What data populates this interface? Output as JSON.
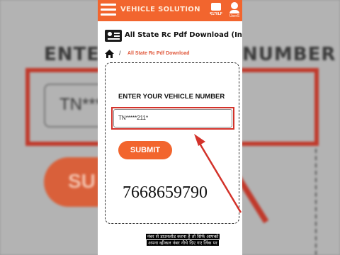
{
  "app": {
    "title": "VEHICLE SOLUTION",
    "wallet_amount": "₹170LF",
    "user_label": "UserS"
  },
  "background": {
    "heading_left": "ENTER",
    "heading_right": "NUMBER",
    "input_value": "TN***",
    "submit_label": "SU"
  },
  "page": {
    "title": "All State Rc Pdf Download (Instan",
    "breadcrumb_separator": "/",
    "breadcrumb_current": "All State Rc Pdf Download"
  },
  "form": {
    "label": "ENTER YOUR VEHICLE NUMBER",
    "input_value": "TN*****211*",
    "submit_label": "SUBMIT"
  },
  "contact_number": "7668659790",
  "caption": {
    "line1": "नंबर से डाउनलोड करना है तो सिर्फ आपको",
    "line2": "अपना व्हीकल नंबर नीचे दिए गए लिंक पर"
  },
  "colors": {
    "accent": "#f2652e",
    "highlight_red": "#d3322a",
    "breadcrumb": "#e0573a"
  },
  "icons": {
    "menu": "hamburger-icon",
    "wallet": "wallet-icon",
    "user": "user-icon",
    "card": "id-card-icon",
    "home": "home-icon",
    "arrow": "red-arrow-icon"
  }
}
